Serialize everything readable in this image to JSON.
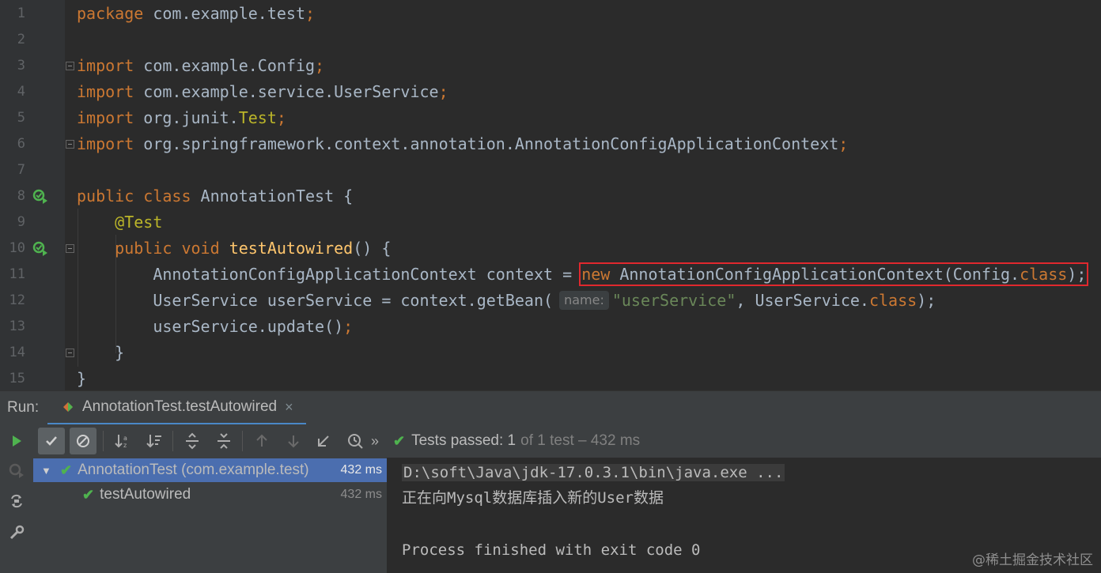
{
  "editor": {
    "lines": [
      {
        "n": "1"
      },
      {
        "n": "2"
      },
      {
        "n": "3"
      },
      {
        "n": "4"
      },
      {
        "n": "5"
      },
      {
        "n": "6"
      },
      {
        "n": "7"
      },
      {
        "n": "8"
      },
      {
        "n": "9"
      },
      {
        "n": "10"
      },
      {
        "n": "11"
      },
      {
        "n": "12"
      },
      {
        "n": "13"
      },
      {
        "n": "14"
      },
      {
        "n": "15"
      }
    ],
    "tokens": {
      "package_kw": "package",
      "package_name": " com.example.test",
      "import_kw": "import",
      "imp1": " com.example.Config",
      "imp2": " com.example.service.UserService",
      "imp3a": " org.junit.",
      "imp3b": "Test",
      "imp4": " org.springframework.context.annotation.AnnotationConfigApplicationContext",
      "semi": ";",
      "public_kw": "public",
      "class_kw": "class",
      "class_name": " AnnotationTest {",
      "annotation": "@Test",
      "void_kw": "void",
      "method_name": "testAutowired",
      "method_tail": "() {",
      "l11_a": "AnnotationConfigApplicationContext context = ",
      "new_kw": "new",
      "l11_b": " AnnotationConfigApplicationContext(Config.",
      "class_lit": "class",
      "l11_c": ");",
      "l12_a": "UserService userService = context.getBean(",
      "param_hint": "name:",
      "l12_str": "\"userService\"",
      "l12_b": ", UserService.",
      "l12_c": ");",
      "l13_a": "userService.update()",
      "close_brace": "}"
    }
  },
  "run": {
    "label": "Run:",
    "tab_title": "AnnotationTest.testAutowired",
    "tab_close": "×",
    "more": "»",
    "status_main": "Tests passed:",
    "status_count": "1",
    "status_rest": "of 1 test – 432 ms",
    "tree": [
      {
        "label": "AnnotationTest (com.example.test)",
        "time": "432 ms"
      },
      {
        "label": "testAutowired",
        "time": "432 ms"
      }
    ],
    "console": [
      "D:\\soft\\Java\\jdk-17.0.3.1\\bin\\java.exe ...",
      "正在向Mysql数据库插入新的User数据",
      "",
      "Process finished with exit code 0"
    ]
  },
  "watermark": "@稀土掘金技术社区",
  "colors": {
    "keyword": "#cc7832",
    "annotation": "#bbb529",
    "function": "#ffc66d",
    "string": "#6a8759",
    "pass": "#4fb34f",
    "selection": "#4b6eaf",
    "highlight_box": "#e0282e"
  }
}
